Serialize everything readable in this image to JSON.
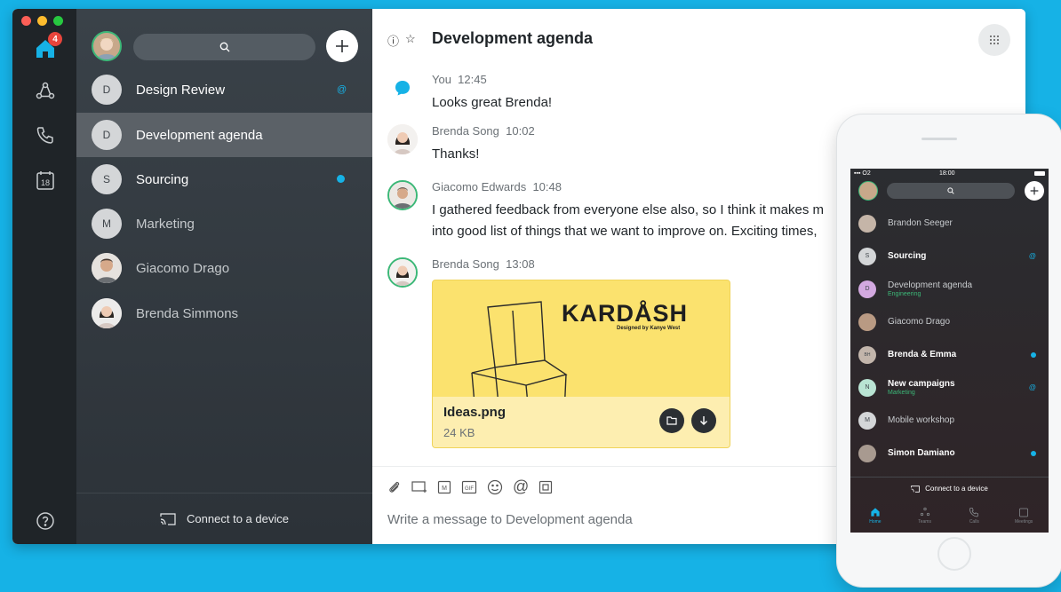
{
  "rail": {
    "home_badge": "4",
    "calendar_day": "18"
  },
  "list": {
    "items": [
      {
        "initial": "D",
        "name": "Design Review",
        "marker": "mention"
      },
      {
        "initial": "D",
        "name": "Development agenda",
        "marker": "none"
      },
      {
        "initial": "S",
        "name": "Sourcing",
        "marker": "dot"
      },
      {
        "initial": "M",
        "name": "Marketing",
        "marker": "none"
      },
      {
        "initial": "",
        "name": "Giacomo Drago",
        "marker": "none"
      },
      {
        "initial": "",
        "name": "Brenda Simmons",
        "marker": "none"
      }
    ],
    "connect_label": "Connect to a device"
  },
  "header": {
    "title": "Development agenda"
  },
  "messages": [
    {
      "author": "You",
      "time": "12:45",
      "lines": [
        "Looks great Brenda!"
      ]
    },
    {
      "author": "Brenda Song",
      "time": "10:02",
      "lines": [
        "Thanks!"
      ]
    },
    {
      "author": "Giacomo Edwards",
      "time": "10:48",
      "lines": [
        "I gathered feedback from everyone else also, so I think it makes m",
        "into good list of things that we want to improve on. Exciting times,"
      ]
    },
    {
      "author": "Brenda Song",
      "time": "13:08",
      "lines": []
    }
  ],
  "file": {
    "brand": "KARDÅSH",
    "brand_sub": "Designed by Kanye West",
    "name": "Ideas.png",
    "size": "24 KB"
  },
  "composer": {
    "placeholder": "Write a message to Development agenda"
  },
  "phone": {
    "carrier": "O2",
    "time": "18:00",
    "items": [
      {
        "initial": "",
        "name": "Brandon Seeger",
        "sub": "",
        "bold": false,
        "marker": "none"
      },
      {
        "initial": "S",
        "name": "Sourcing",
        "sub": "",
        "bold": true,
        "marker": "mention"
      },
      {
        "initial": "D",
        "name": "Development agenda",
        "sub": "Engineering",
        "bold": false,
        "marker": "none"
      },
      {
        "initial": "",
        "name": "Giacomo Drago",
        "sub": "",
        "bold": false,
        "marker": "none"
      },
      {
        "initial": "BH",
        "name": "Brenda & Emma",
        "sub": "",
        "bold": true,
        "marker": "dot"
      },
      {
        "initial": "N",
        "name": "New campaigns",
        "sub": "Marketing",
        "bold": true,
        "marker": "mention"
      },
      {
        "initial": "M",
        "name": "Mobile workshop",
        "sub": "",
        "bold": false,
        "marker": "none"
      },
      {
        "initial": "",
        "name": "Simon Damiano",
        "sub": "",
        "bold": true,
        "marker": "dot"
      }
    ],
    "connect_label": "Connect to a device",
    "tabs": [
      "Home",
      "Teams",
      "Calls",
      "Meetings"
    ]
  },
  "colors": {
    "accent": "#16b2e6",
    "presence": "#3cb878",
    "badge": "#e8453c"
  }
}
